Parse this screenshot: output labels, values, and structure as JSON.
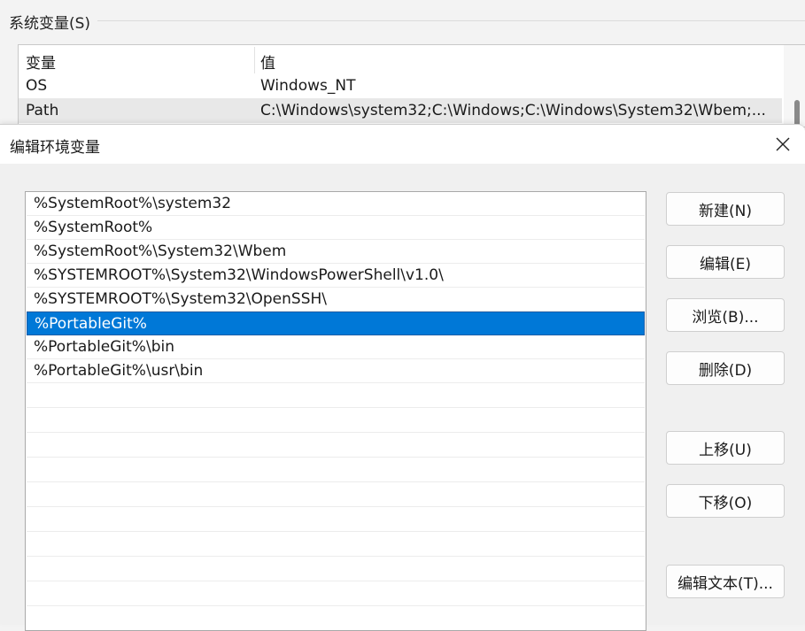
{
  "system_vars": {
    "title": "系统变量(S)",
    "header": {
      "col_var": "变量",
      "col_val": "值"
    },
    "rows": [
      {
        "name": "OS",
        "value": "Windows_NT"
      },
      {
        "name": "Path",
        "value": "C:\\Windows\\system32;C:\\Windows;C:\\Windows\\System32\\Wbem;..."
      }
    ]
  },
  "dialog": {
    "title": "编辑环境变量",
    "entries": [
      "%SystemRoot%\\system32",
      "%SystemRoot%",
      "%SystemRoot%\\System32\\Wbem",
      "%SYSTEMROOT%\\System32\\WindowsPowerShell\\v1.0\\",
      "%SYSTEMROOT%\\System32\\OpenSSH\\",
      "%PortableGit%",
      "%PortableGit%\\bin",
      "%PortableGit%\\usr\\bin"
    ],
    "selected_index": 5,
    "buttons": {
      "new": "新建(N)",
      "edit": "编辑(E)",
      "browse": "浏览(B)...",
      "delete": "删除(D)",
      "move_up": "上移(U)",
      "move_down": "下移(O)",
      "edit_text": "编辑文本(T)..."
    },
    "close_icon": "close-icon"
  }
}
